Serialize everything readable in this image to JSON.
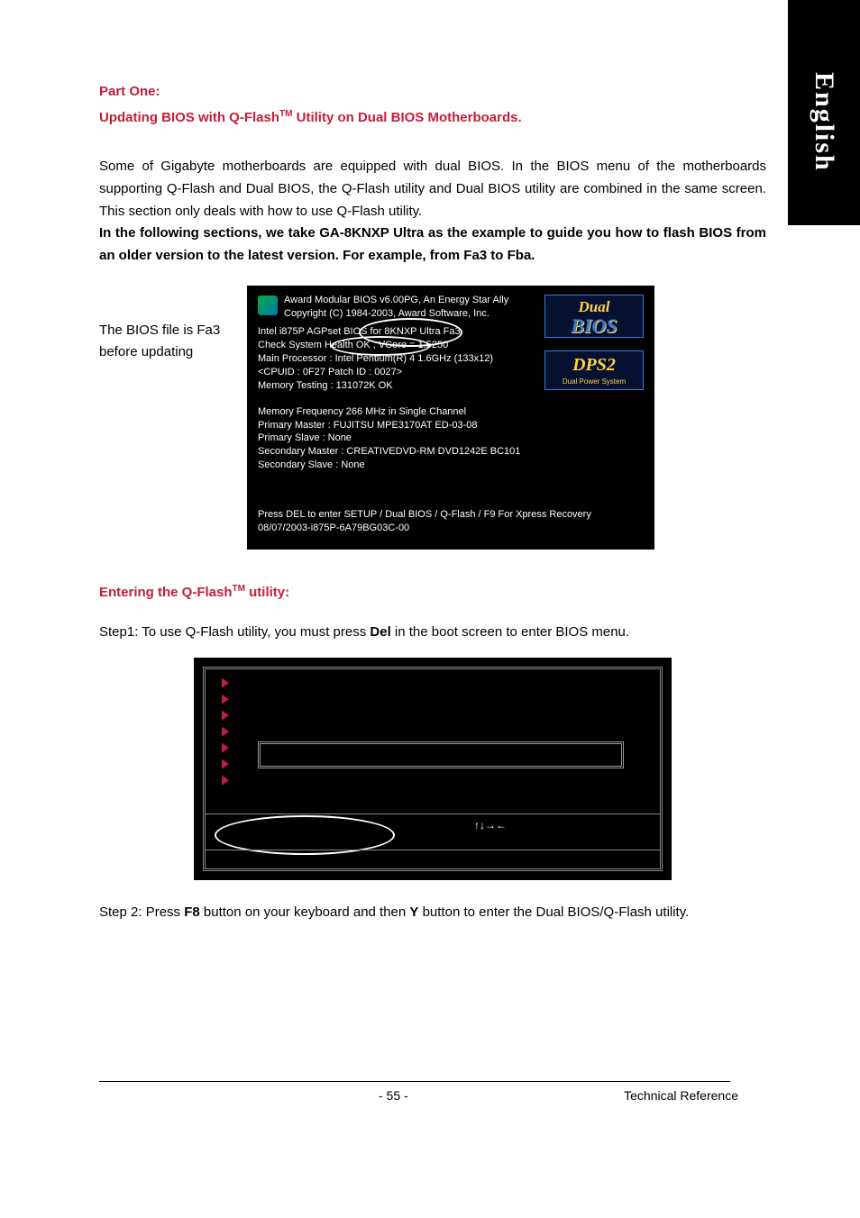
{
  "sideTab": "English",
  "partOne": {
    "label": "Part One:",
    "title_pre": "Updating BIOS with Q-Flash",
    "title_tm": "TM",
    "title_post": " Utility on Dual BIOS Motherboards."
  },
  "intro": "Some of Gigabyte motherboards are equipped with dual BIOS. In the BIOS menu of the motherboards supporting Q-Flash and Dual BIOS, the Q-Flash utility and Dual BIOS utility are combined in the same screen. This section only deals with how to use Q-Flash utility.",
  "introBold": "In the following sections, we take GA-8KNXP Ultra as the example to guide you how to flash BIOS from an older version to the latest version. For example, from Fa3 to Fba.",
  "leftNote": "The BIOS file is Fa3 before updating",
  "bios": {
    "l1": "Award Modular BIOS v6.00PG, An Energy Star Ally",
    "l2": "Copyright (C) 1984-2003, Award Software, Inc.",
    "l3": "Intel i875P AGPset BIOS for 8KNXP Ultra Fa3",
    "l4": "Check System Health OK , VCore = 1.5250",
    "l5": "Main Processor : Intel Pentium(R) 4  1.6GHz (133x12)",
    "l6": "<CPUID : 0F27 Patch ID  : 0027>",
    "l7": "Memory Testing  : 131072K OK",
    "l8": "Memory Frequency 266 MHz in Single Channel",
    "l9": "Primary Master : FUJITSU MPE3170AT ED-03-08",
    "l10": "Primary Slave : None",
    "l11": "Secondary Master : CREATIVEDVD-RM DVD1242E BC101",
    "l12": "Secondary Slave : None",
    "l13": "Press DEL to enter SETUP / Dual BIOS / Q-Flash / F9 For Xpress Recovery",
    "l14": "08/07/2003-i875P-6A79BG03C-00"
  },
  "logos": {
    "dual1": "Dual",
    "dual2": "BIOS",
    "dps1": "DPS2",
    "dps2": "Dual Power System"
  },
  "section2_pre": "Entering the Q-Flash",
  "section2_tm": "TM",
  "section2_post": " utility:",
  "step1_pre": "Step1: To use Q-Flash utility, you must press ",
  "step1_bold": "Del",
  "step1_post": " in the boot screen to enter BIOS menu.",
  "arrows": "↑↓→←",
  "step2_pre": "Step 2: Press ",
  "step2_b1": "F8",
  "step2_mid": " button on your keyboard and then ",
  "step2_b2": "Y",
  "step2_post": " button to enter the Dual BIOS/Q-Flash utility.",
  "footerPage": "- 55 -",
  "footerRight": "Technical Reference"
}
